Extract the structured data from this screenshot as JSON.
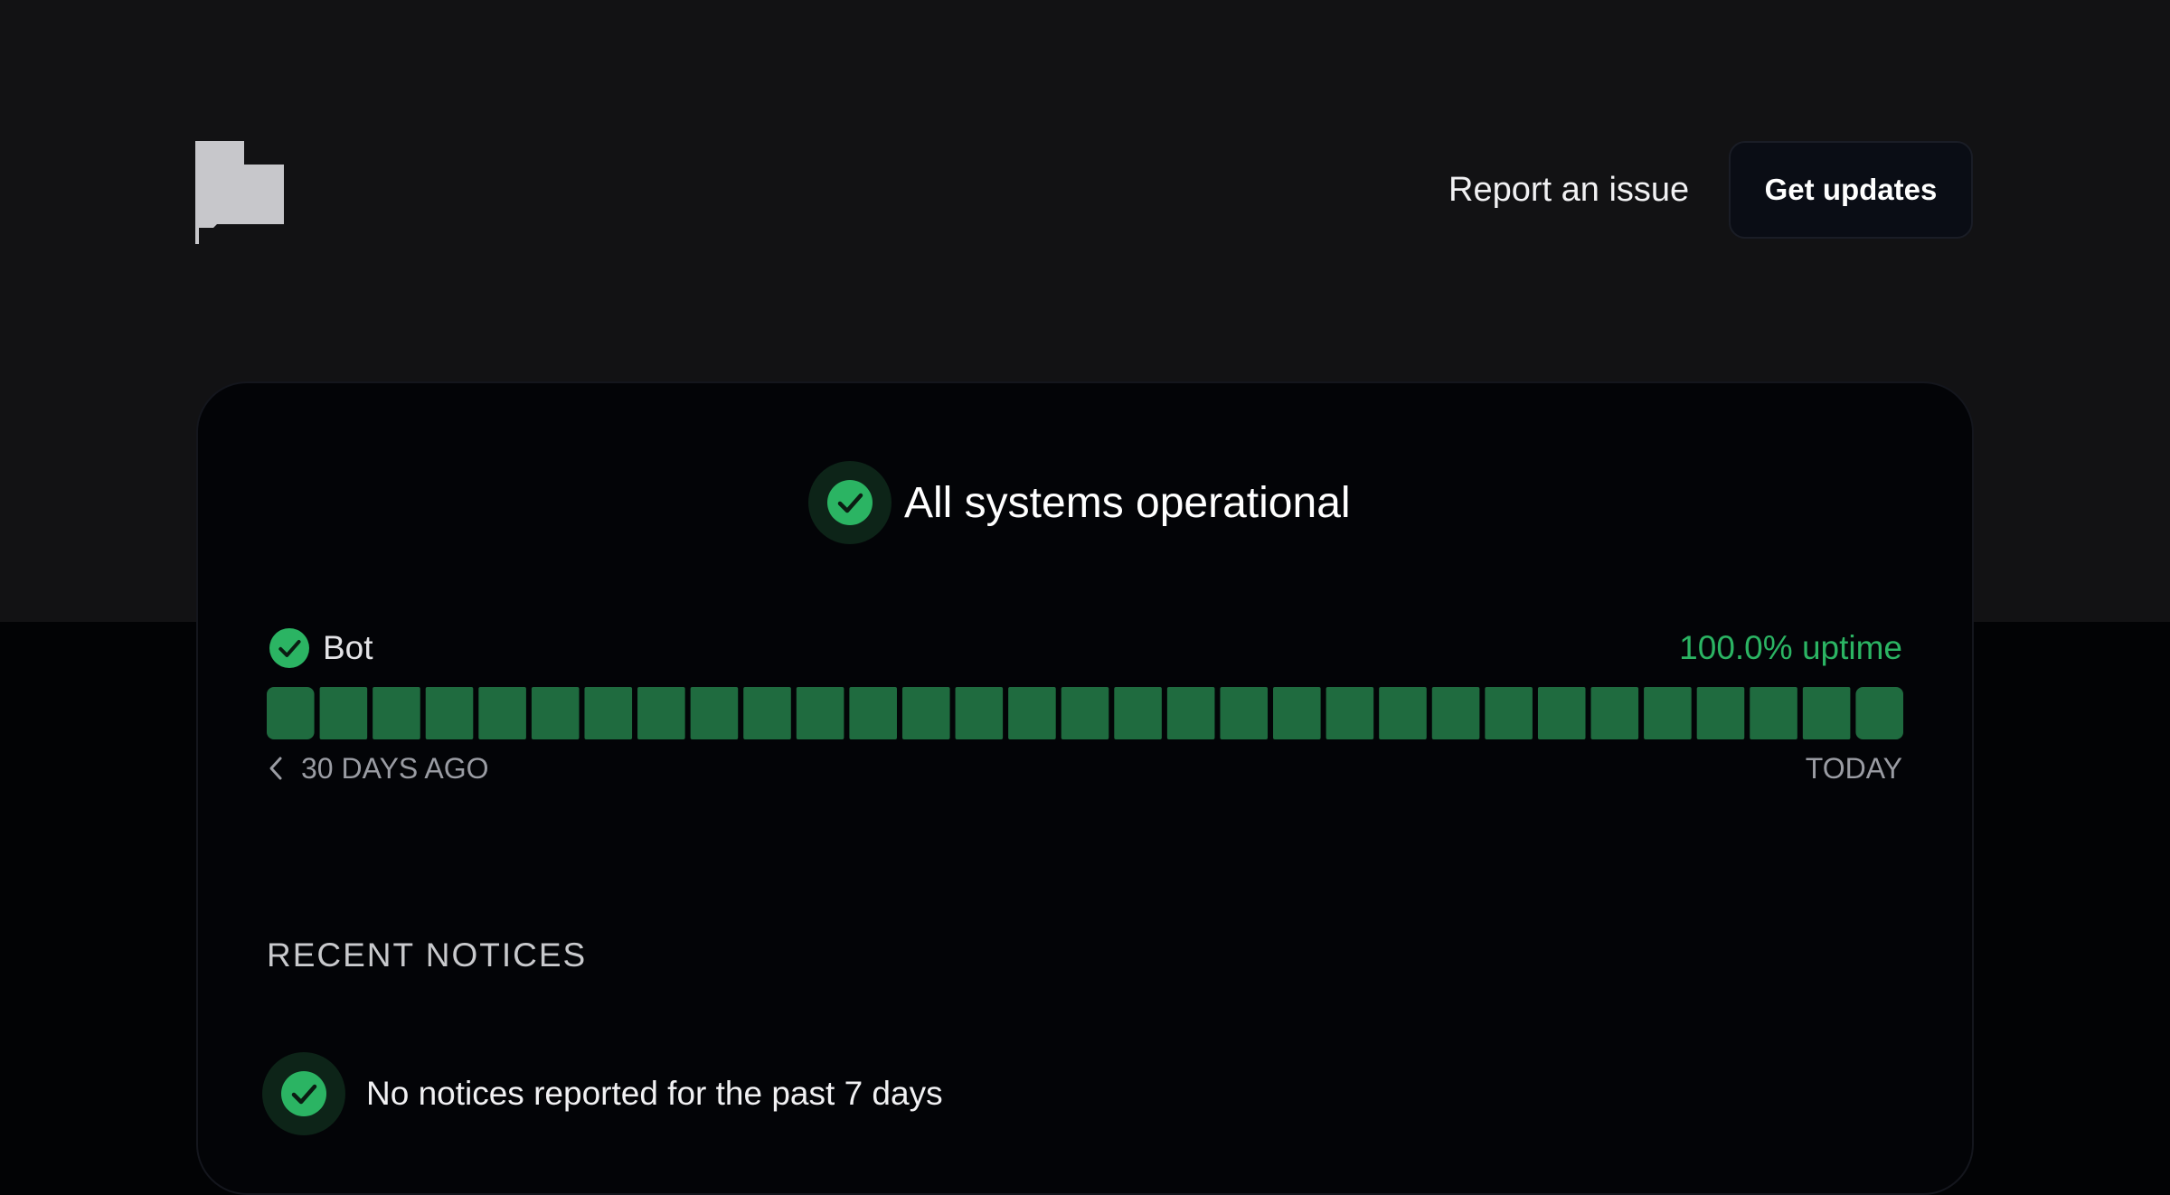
{
  "header": {
    "logo_icon": "flag-icon",
    "report_label": "Report an issue",
    "updates_label": "Get updates"
  },
  "overall_status": {
    "icon": "check-circle-icon",
    "title": "All systems operational"
  },
  "components": [
    {
      "name": "Bot",
      "status_icon": "check-circle-icon",
      "uptime_text": "100.0% uptime",
      "uptime_days": [
        1,
        1,
        1,
        1,
        1,
        1,
        1,
        1,
        1,
        1,
        1,
        1,
        1,
        1,
        1,
        1,
        1,
        1,
        1,
        1,
        1,
        1,
        1,
        1,
        1,
        1,
        1,
        1,
        1,
        1,
        1
      ],
      "axis_start_label": "30 DAYS AGO",
      "axis_end_label": "TODAY"
    }
  ],
  "recent_notices": {
    "heading": "RECENT NOTICES",
    "empty_icon": "check-circle-icon",
    "empty_text": "No notices reported for the past 7 days"
  },
  "colors": {
    "page_background": "#121214",
    "card_background": "#030407",
    "operational_green": "#2bb463",
    "bar_green": "#1f6b3f",
    "badge_background": "#0d2418"
  }
}
